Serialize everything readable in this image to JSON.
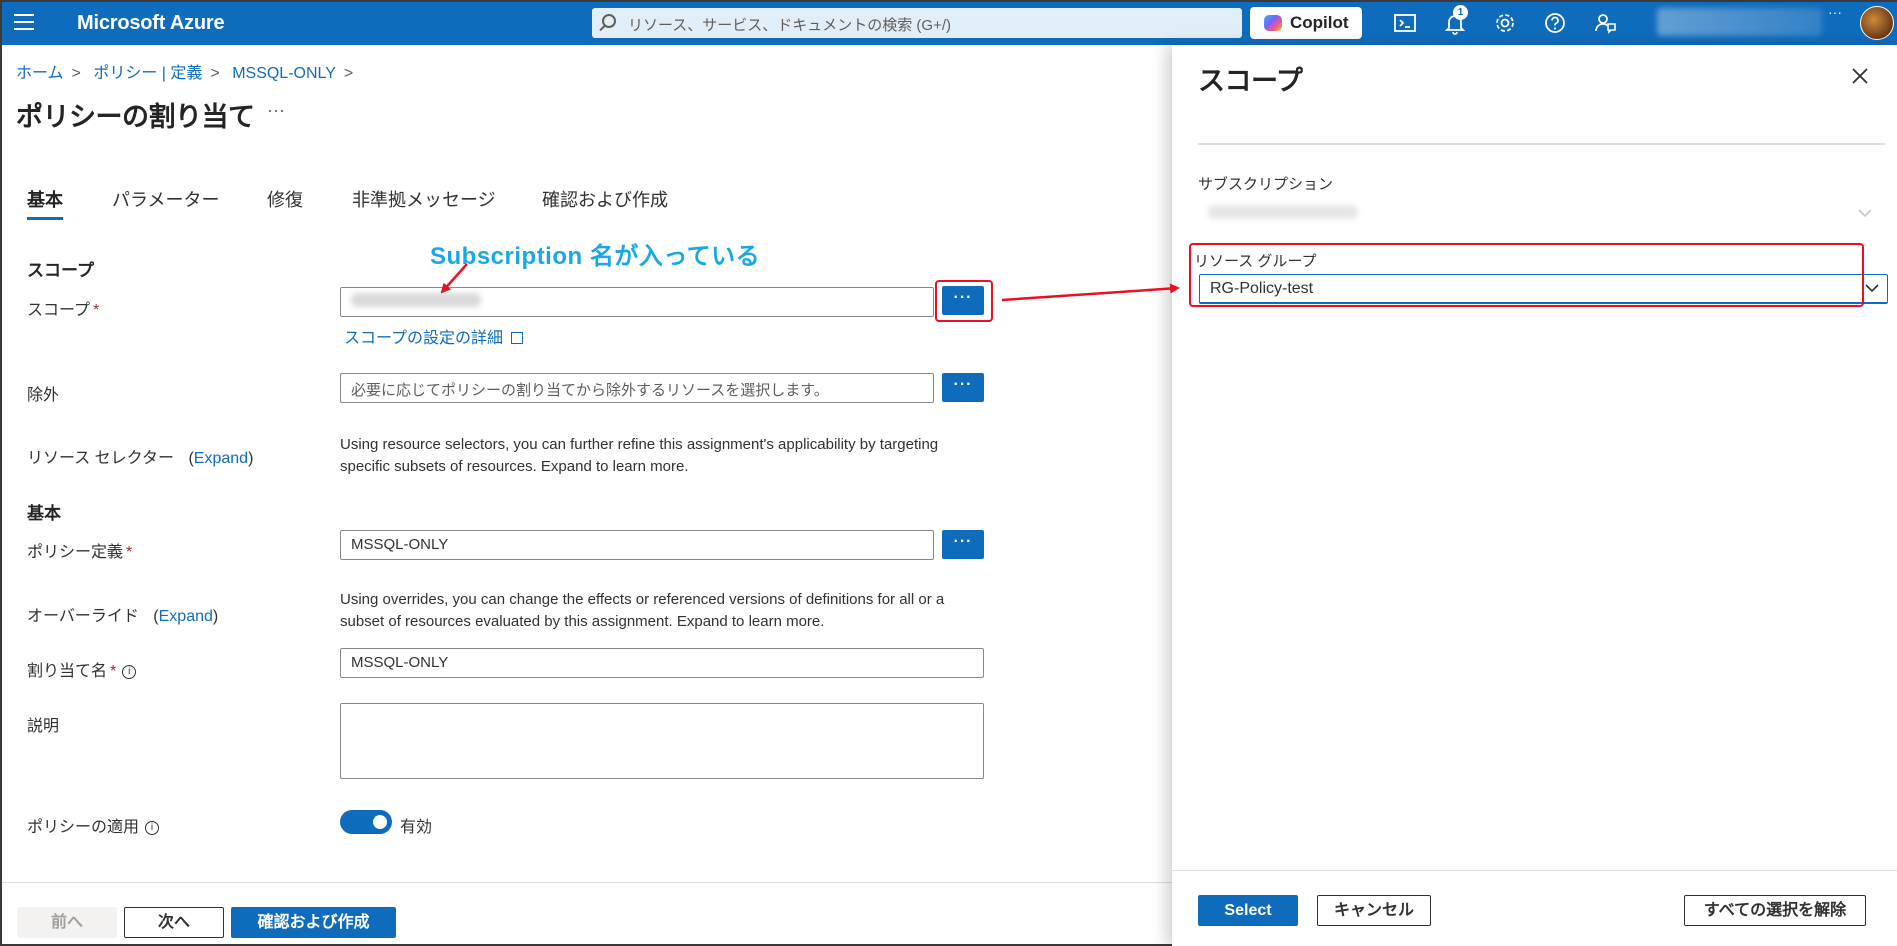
{
  "topbar": {
    "brand": "Microsoft Azure",
    "search_placeholder": "リソース、サービス、ドキュメントの検索 (G+/)",
    "copilot_label": "Copilot",
    "notification_count": "1",
    "more": "···"
  },
  "breadcrumb": {
    "items": [
      "ホーム",
      "ポリシー | 定義",
      "MSSQL-ONLY"
    ]
  },
  "page": {
    "title": "ポリシーの割り当て",
    "more": "···"
  },
  "tabs": [
    "基本",
    "パラメーター",
    "修復",
    "非準拠メッセージ",
    "確認および作成"
  ],
  "form": {
    "scope_section": "スコープ",
    "scope_label": "スコープ",
    "required_mark": "*",
    "scope_details_link": "スコープの設定の詳細",
    "exclusions_label": "除外",
    "exclusions_placeholder": "必要に応じてポリシーの割り当てから除外するリソースを選択します。",
    "resource_selectors_label": "リソース セレクター",
    "expand_link": "Expand",
    "resource_selectors_desc": "Using resource selectors, you can further refine this assignment's applicability by targeting specific subsets of resources. Expand to learn more.",
    "basics_section": "基本",
    "policy_definition_label": "ポリシー定義",
    "policy_definition_value": "MSSQL-ONLY",
    "overrides_label": "オーバーライド",
    "overrides_desc": "Using overrides, you can change the effects or referenced versions of definitions for all or a subset of resources evaluated by this assignment. Expand to learn more.",
    "assignment_name_label": "割り当て名",
    "assignment_name_value": "MSSQL-ONLY",
    "description_label": "説明",
    "enforcement_label": "ポリシーの適用",
    "enforcement_value": "有効",
    "browse_button": "···"
  },
  "footer": {
    "prev": "前へ",
    "next": "次へ",
    "review_create": "確認および作成"
  },
  "annotation": {
    "text": "Subscription 名が入っている",
    "highlight_color": "#e81123",
    "text_color": "#1aa7e6"
  },
  "panel": {
    "title": "スコープ",
    "subscription_label": "サブスクリプション",
    "resource_group_label": "リソース グループ",
    "resource_group_value": "RG-Policy-test",
    "select_button": "Select",
    "cancel_button": "キャンセル",
    "clear_button": "すべての選択を解除"
  },
  "colors": {
    "accent": "#0f6cbd",
    "topbar": "#0f6cbd"
  }
}
